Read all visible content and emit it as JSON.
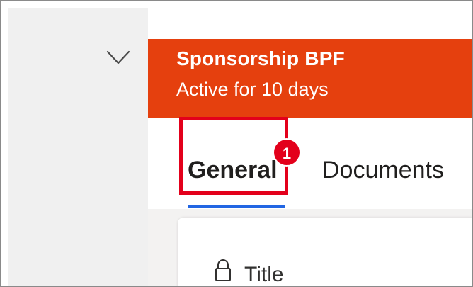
{
  "sidebar": {
    "toggle_icon": "chevron-down-icon"
  },
  "process": {
    "title": "Sponsorship BPF",
    "status": "Active for 10 days"
  },
  "tabs": [
    {
      "label": "General",
      "selected": true
    },
    {
      "label": "Documents",
      "selected": false
    }
  ],
  "callout": {
    "number": "1"
  },
  "form": {
    "fields": [
      {
        "label": "Title",
        "icon": "lock-icon"
      }
    ]
  },
  "colors": {
    "banner": "#e5400e",
    "tab_underline": "#2266e3",
    "callout": "#e3001b",
    "sidebar_bg": "#f0f0f0"
  }
}
